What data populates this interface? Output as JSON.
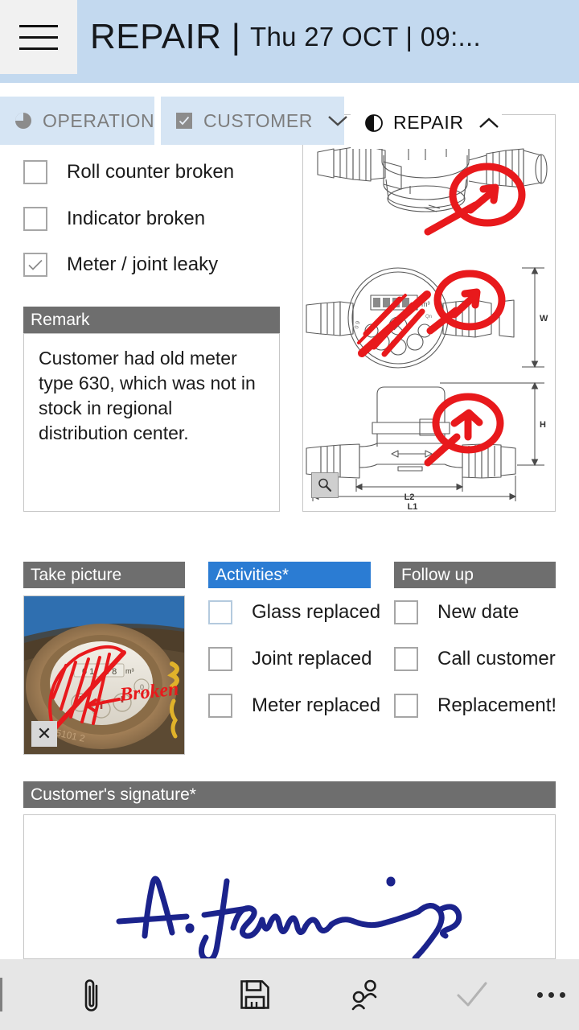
{
  "header": {
    "menu_icon": "hamburger-menu-icon",
    "title": "REPAIR",
    "separator": "|",
    "subtitle": "Thu 27 OCT | 09:...",
    "background_color": "#c3d9ef"
  },
  "tabs": [
    {
      "id": "operation",
      "label": "OPERATION",
      "icon": "pie-chart-icon",
      "active": false,
      "chevron": ""
    },
    {
      "id": "customer",
      "label": "CUSTOMER",
      "icon": "checkbox-checked-icon",
      "active": false,
      "chevron": "chevron-down-icon"
    },
    {
      "id": "repair",
      "label": "REPAIR",
      "icon": "half-circle-icon",
      "active": true,
      "chevron": "chevron-up-icon"
    }
  ],
  "damage_checklist": [
    {
      "label": "Roll counter broken",
      "checked": false
    },
    {
      "label": "Indicator broken",
      "checked": false
    },
    {
      "label": "Meter / joint leaky",
      "checked": true
    }
  ],
  "remark": {
    "header": "Remark",
    "value": "Customer had old meter type 630, which was not in stock in regional distribution center.",
    "placeholder": ""
  },
  "drawing": {
    "zoom_icon": "magnifier-icon",
    "dimension_labels": [
      "W",
      "H",
      "L2",
      "L1"
    ],
    "annotation_color": "#e8191c",
    "display_value": "0 0 0 m³"
  },
  "take_picture": {
    "header": "Take picture",
    "remove_icon": "close-icon",
    "annotation_text": "Broken"
  },
  "activities": {
    "header": "Activities*",
    "header_color": "#2b7cd3",
    "required": true,
    "items": [
      {
        "label": "Glass replaced",
        "checked": false,
        "highlight": true
      },
      {
        "label": "Joint replaced",
        "checked": false,
        "highlight": false
      },
      {
        "label": "Meter replaced",
        "checked": false,
        "highlight": false
      }
    ]
  },
  "follow_up": {
    "header": "Follow up",
    "header_color": "#6e6e6e",
    "items": [
      {
        "label": "New date",
        "checked": false
      },
      {
        "label": "Call customer",
        "checked": false
      },
      {
        "label": "Replacement!",
        "checked": false
      }
    ]
  },
  "signature": {
    "header": "Customer's signature*",
    "required": true,
    "signed_name": "A. Jennings",
    "ink_color": "#1b238c"
  },
  "toolbar": {
    "background_color": "#e6e6e6",
    "buttons": [
      {
        "id": "attach",
        "icon": "paperclip-icon",
        "label": "Attach",
        "enabled": true
      },
      {
        "id": "save",
        "icon": "floppy-disk-icon",
        "label": "Save",
        "enabled": true
      },
      {
        "id": "people",
        "icon": "people-icon",
        "label": "Contacts",
        "enabled": true
      },
      {
        "id": "confirm",
        "icon": "checkmark-icon",
        "label": "Confirm",
        "enabled": false
      },
      {
        "id": "more",
        "icon": "ellipsis-icon",
        "label": "More",
        "enabled": true
      }
    ]
  }
}
